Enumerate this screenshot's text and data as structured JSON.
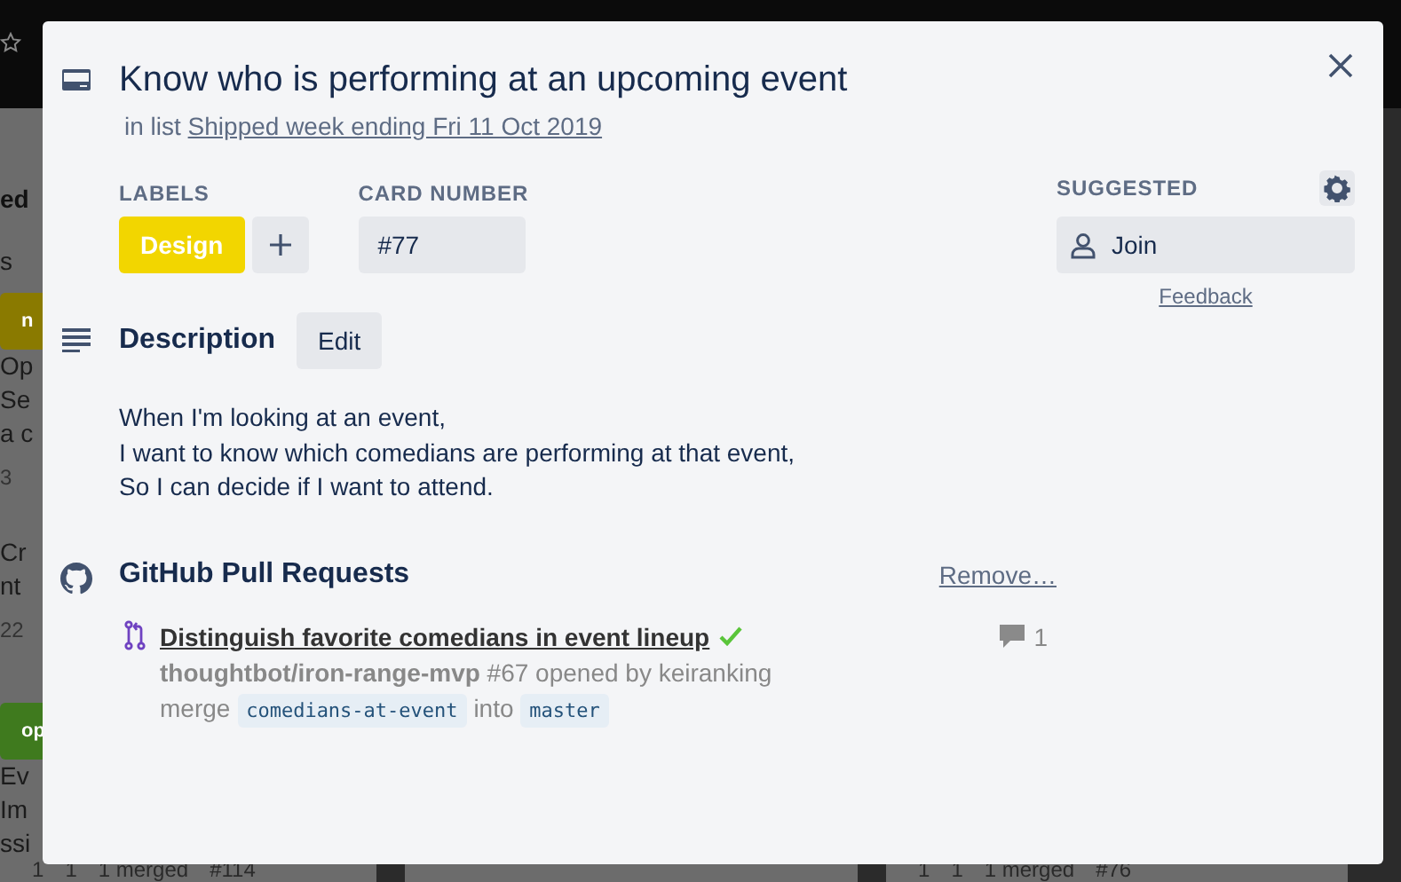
{
  "board": {
    "left_list": [
      {
        "kind": "title",
        "text": "ed"
      },
      {
        "kind": "text",
        "text": "s"
      },
      {
        "kind": "label",
        "text": "n",
        "color": "#8a7a00"
      },
      {
        "kind": "card",
        "text": "Op"
      },
      {
        "kind": "text",
        "text": "Se"
      },
      {
        "kind": "text",
        "text": "a c"
      },
      {
        "kind": "meta",
        "text": "3"
      },
      {
        "kind": "divider"
      },
      {
        "kind": "card",
        "text": "Cr"
      },
      {
        "kind": "text",
        "text": "nt"
      },
      {
        "kind": "meta",
        "text": "22"
      },
      {
        "kind": "divider"
      },
      {
        "kind": "label",
        "text": "op",
        "color": "#3f7a1e"
      },
      {
        "kind": "card",
        "text": "Ev"
      },
      {
        "kind": "text",
        "text": "Im"
      },
      {
        "kind": "text",
        "text": "ssi"
      }
    ],
    "footers": [
      {
        "items": [
          "1",
          "1",
          "1 merged",
          "#114"
        ]
      },
      {
        "items": [
          "1",
          "1",
          "1 merged",
          "#76"
        ]
      }
    ]
  },
  "card": {
    "title": "Know who is performing at an upcoming event",
    "list_prefix": "in list",
    "list_name": "Shipped week ending Fri 11 Oct 2019",
    "labels_heading": "LABELS",
    "labels": [
      {
        "text": "Design",
        "color": "#f2d600"
      }
    ],
    "card_number_heading": "CARD NUMBER",
    "card_number": "#77",
    "description": {
      "heading": "Description",
      "edit": "Edit",
      "lines": [
        "When I'm looking at an event,",
        "I want to know which comedians are performing at that event,",
        "So I can decide if I want to attend."
      ]
    },
    "github": {
      "heading": "GitHub Pull Requests",
      "remove": "Remove…",
      "pull_requests": [
        {
          "title": "Distinguish favorite comedians in event lineup",
          "passed": true,
          "comments": "1",
          "meta": "**thoughtbot/iron-range-mvp** #67 opened by keiranking",
          "merge_word": "merge",
          "head": "comedians-at-event",
          "into_word": "into",
          "base": "master"
        }
      ]
    },
    "sidebar": {
      "heading": "SUGGESTED",
      "join": "Join",
      "feedback": "Feedback"
    }
  }
}
